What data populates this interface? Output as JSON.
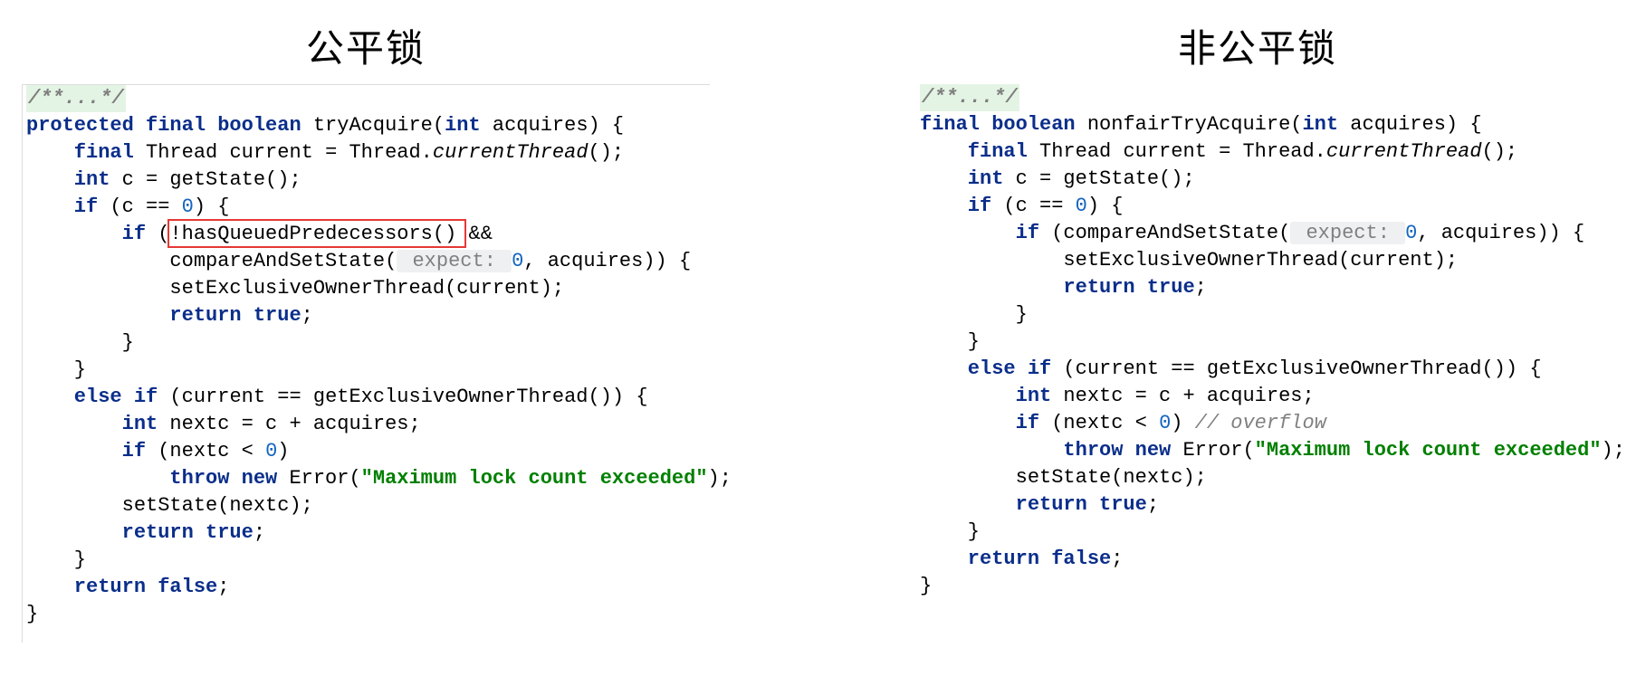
{
  "left": {
    "title": "公平锁",
    "doc": "/**...*/",
    "lines": {
      "l1a": "protected final boolean",
      "l1b": " tryAcquire(",
      "l1c": "int",
      "l1d": " acquires) {",
      "l2a": "    final",
      "l2b": " Thread current = Thread.",
      "l2c": "currentThread",
      "l2d": "();",
      "l3a": "    int",
      "l3b": " c = getState();",
      "l4a": "    if",
      "l4b": " (c == ",
      "l4c": "0",
      "l4d": ") {",
      "l5a": "        if",
      "l5b": " (",
      "l5c": "!hasQueuedPredecessors()",
      "l5d": " &&",
      "l6a": "            compareAndSetState(",
      "l6b": " expect: ",
      "l6c": "0",
      "l6d": ", acquires)) {",
      "l7": "            setExclusiveOwnerThread(current);",
      "l8a": "            return true",
      "l8b": ";",
      "l9": "        }",
      "l10": "    }",
      "l11a": "    else if",
      "l11b": " (current == getExclusiveOwnerThread()) {",
      "l12a": "        int",
      "l12b": " nextc = c + acquires;",
      "l13a": "        if",
      "l13b": " (nextc < ",
      "l13c": "0",
      "l13d": ")",
      "l14a": "            throw new",
      "l14b": " Error(",
      "l14c": "\"Maximum lock count exceeded\"",
      "l14d": ");",
      "l15": "        setState(nextc);",
      "l16a": "        return true",
      "l16b": ";",
      "l17": "    }",
      "l18a": "    return false",
      "l18b": ";",
      "l19": "}"
    }
  },
  "right": {
    "title": "非公平锁",
    "doc": "/**...*/",
    "lines": {
      "l1a": "final boolean",
      "l1b": " nonfairTryAcquire(",
      "l1c": "int",
      "l1d": " acquires) {",
      "l2a": "    final",
      "l2b": " Thread current = Thread.",
      "l2c": "currentThread",
      "l2d": "();",
      "l3a": "    int",
      "l3b": " c = getState();",
      "l4a": "    if",
      "l4b": " (c == ",
      "l4c": "0",
      "l4d": ") {",
      "l5a": "        if",
      "l5b": " (compareAndSetState(",
      "l5c": " expect: ",
      "l5d": "0",
      "l5e": ", acquires)) {",
      "l6": "            setExclusiveOwnerThread(current);",
      "l7a": "            return true",
      "l7b": ";",
      "l8": "        }",
      "l9": "    }",
      "l10a": "    else if",
      "l10b": " (current == getExclusiveOwnerThread()) {",
      "l11a": "        int",
      "l11b": " nextc = c + acquires;",
      "l12a": "        if",
      "l12b": " (nextc < ",
      "l12c": "0",
      "l12d": ") ",
      "l12e": "// overflow",
      "l13a": "            throw new",
      "l13b": " Error(",
      "l13c": "\"Maximum lock count exceeded\"",
      "l13d": ");",
      "l14": "        setState(nextc);",
      "l15a": "        return true",
      "l15b": ";",
      "l16": "    }",
      "l17a": "    return false",
      "l17b": ";",
      "l18": "}"
    }
  }
}
